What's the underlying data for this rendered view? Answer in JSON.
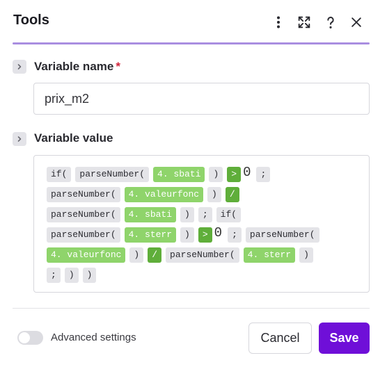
{
  "header": {
    "title": "Tools",
    "accent_color": "#a98ee0"
  },
  "variable_name": {
    "label": "Variable name",
    "required_mark": "*",
    "value": "prix_m2"
  },
  "variable_value": {
    "label": "Variable value",
    "lines": [
      [
        {
          "t": "fn",
          "v": "if("
        },
        {
          "t": "fn",
          "v": "parseNumber("
        },
        {
          "t": "var",
          "v": "4. sbati"
        },
        {
          "t": "fn",
          "v": ")"
        },
        {
          "t": "op",
          "v": ">"
        },
        {
          "t": "lit",
          "v": "0"
        },
        {
          "t": "fn",
          "v": ";"
        }
      ],
      [
        {
          "t": "fn",
          "v": "parseNumber("
        },
        {
          "t": "var",
          "v": "4. valeurfonc"
        },
        {
          "t": "fn",
          "v": ")"
        },
        {
          "t": "op",
          "v": "/"
        }
      ],
      [
        {
          "t": "fn",
          "v": "parseNumber("
        },
        {
          "t": "var",
          "v": "4. sbati"
        },
        {
          "t": "fn",
          "v": ")"
        },
        {
          "t": "fn",
          "v": ";"
        },
        {
          "t": "fn",
          "v": "if("
        }
      ],
      [
        {
          "t": "fn",
          "v": "parseNumber("
        },
        {
          "t": "var",
          "v": "4. sterr"
        },
        {
          "t": "fn",
          "v": ")"
        },
        {
          "t": "op",
          "v": ">"
        },
        {
          "t": "lit",
          "v": "0"
        },
        {
          "t": "fn",
          "v": ";"
        },
        {
          "t": "fn",
          "v": "parseNumber("
        }
      ],
      [
        {
          "t": "var",
          "v": "4. valeurfonc"
        },
        {
          "t": "fn",
          "v": ")"
        },
        {
          "t": "op",
          "v": "/"
        },
        {
          "t": "fn",
          "v": "parseNumber("
        },
        {
          "t": "var",
          "v": "4. sterr"
        },
        {
          "t": "fn",
          "v": ")"
        }
      ],
      [
        {
          "t": "fn",
          "v": ";"
        },
        {
          "t": "fn",
          "v": ")"
        },
        {
          "t": "fn",
          "v": ")"
        }
      ]
    ]
  },
  "footer": {
    "advanced_label": "Advanced settings",
    "advanced_enabled": false,
    "cancel_label": "Cancel",
    "save_label": "Save",
    "save_color": "#6f0fd8"
  },
  "icons": {
    "menu": "more-vertical-icon",
    "expand": "expand-icon",
    "help": "help-icon",
    "close": "close-icon",
    "chevron": "chevron-right-icon"
  }
}
